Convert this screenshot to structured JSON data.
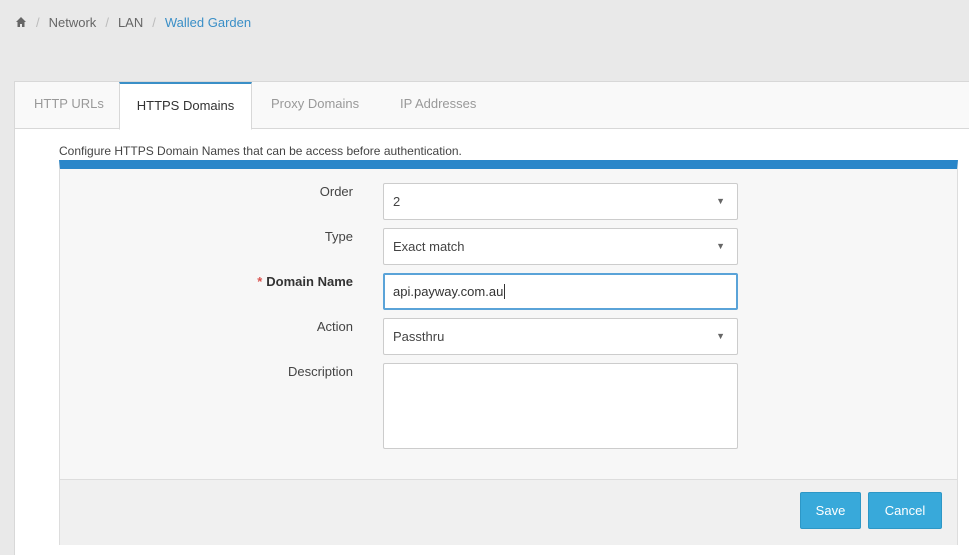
{
  "breadcrumb": {
    "home_icon": "home-icon",
    "items": [
      "Network",
      "LAN",
      "Walled Garden"
    ],
    "separator": "/"
  },
  "tabs": [
    {
      "label": "HTTP URLs",
      "active": false
    },
    {
      "label": "HTTPS Domains",
      "active": true
    },
    {
      "label": "Proxy Domains",
      "active": false
    },
    {
      "label": "IP Addresses",
      "active": false
    }
  ],
  "description": "Configure HTTPS Domain Names that can be access before authentication.",
  "form": {
    "order": {
      "label": "Order",
      "value": "2"
    },
    "type": {
      "label": "Type",
      "value": "Exact match"
    },
    "domain_name": {
      "label": "Domain Name",
      "required_mark": "*",
      "value": "api.payway.com.au"
    },
    "action": {
      "label": "Action",
      "value": "Passthru"
    },
    "description": {
      "label": "Description",
      "value": ""
    },
    "caret": "▼"
  },
  "buttons": {
    "save": "Save",
    "cancel": "Cancel"
  },
  "colors": {
    "accent": "#2a86c9",
    "button": "#38a9da",
    "link": "#3a8fc7",
    "required": "#d9534f"
  }
}
